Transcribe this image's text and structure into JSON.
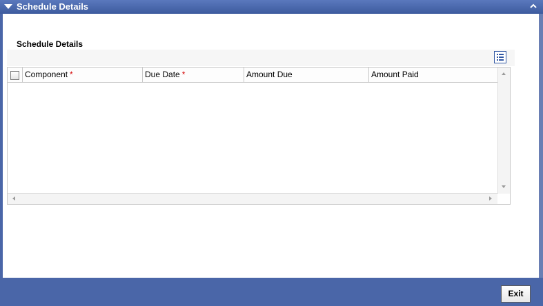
{
  "window": {
    "title": "Schedule Details"
  },
  "section": {
    "title": "Schedule Details"
  },
  "grid": {
    "columns": [
      {
        "label": "Component",
        "required": true
      },
      {
        "label": "Due Date",
        "required": true
      },
      {
        "label": "Amount Due",
        "required": false
      },
      {
        "label": "Amount Paid",
        "required": false
      }
    ],
    "required_marker": "*",
    "rows": []
  },
  "footer": {
    "exit_label": "Exit"
  },
  "icons": {
    "header": "chevron-down-icon",
    "collapse": "chevron-up-icon",
    "grid_menu": "list-view-icon"
  },
  "colors": {
    "frame": "#4a66a8",
    "required": "#d40000"
  }
}
